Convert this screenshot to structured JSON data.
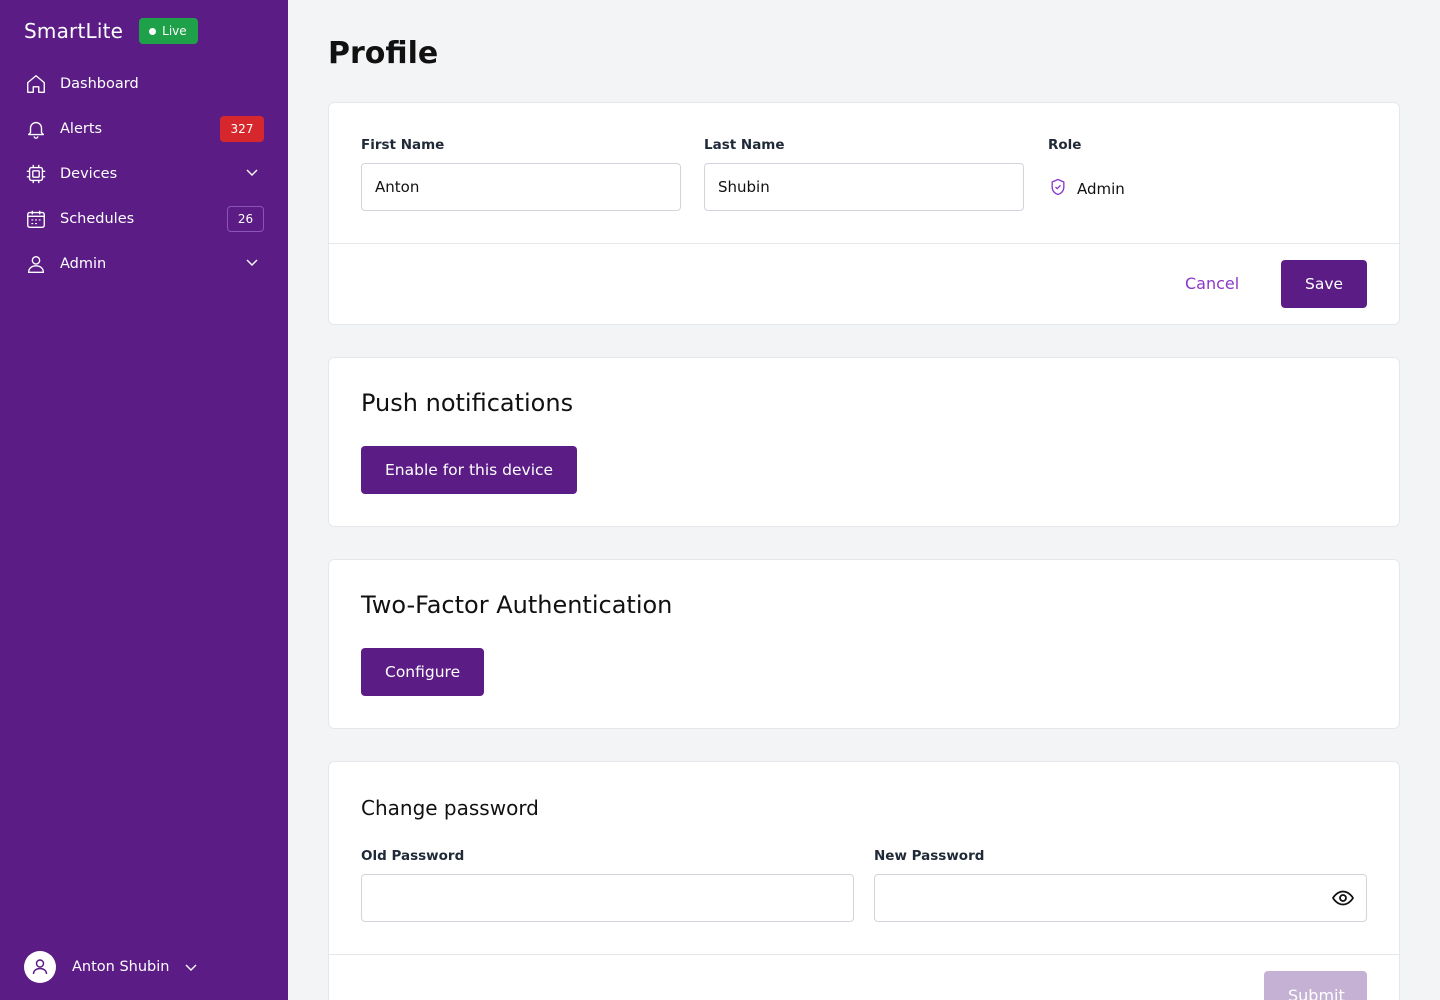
{
  "app": {
    "brand": "SmartLite",
    "status_badge": "Live"
  },
  "sidebar": {
    "items": [
      {
        "label": "Dashboard",
        "icon": "home-icon"
      },
      {
        "label": "Alerts",
        "icon": "bell-icon",
        "badge": "327"
      },
      {
        "label": "Devices",
        "icon": "chip-icon",
        "expandable": true
      },
      {
        "label": "Schedules",
        "icon": "calendar-icon",
        "badge": "26"
      },
      {
        "label": "Admin",
        "icon": "user-icon",
        "expandable": true
      }
    ],
    "user": {
      "name": "Anton Shubin"
    }
  },
  "page": {
    "title": "Profile"
  },
  "profile": {
    "first_name_label": "First Name",
    "first_name_value": "Anton",
    "last_name_label": "Last Name",
    "last_name_value": "Shubin",
    "role_label": "Role",
    "role_value": "Admin",
    "cancel_label": "Cancel",
    "save_label": "Save"
  },
  "push": {
    "title": "Push notifications",
    "button_label": "Enable for this device"
  },
  "two_factor": {
    "title": "Two-Factor Authentication",
    "button_label": "Configure"
  },
  "password": {
    "title": "Change password",
    "old_label": "Old Password",
    "old_value": "",
    "new_label": "New Password",
    "new_value": "",
    "submit_label": "Submit"
  },
  "colors": {
    "sidebar_bg": "#5b1c86",
    "live_badge": "#1fa149",
    "alert_badge": "#d6282c",
    "primary": "#5b1c86",
    "link": "#8b38c8"
  }
}
